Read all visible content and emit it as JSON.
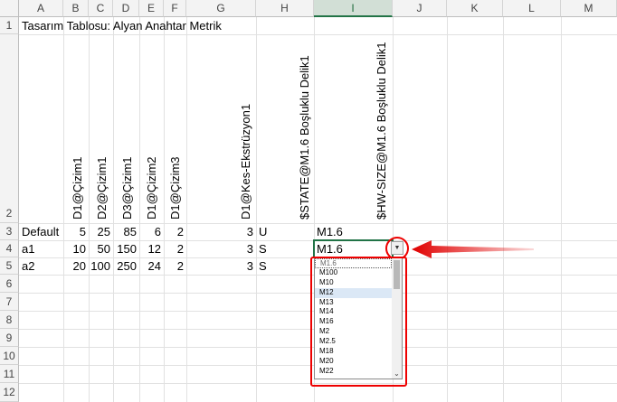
{
  "columns": [
    "A",
    "B",
    "C",
    "D",
    "E",
    "F",
    "G",
    "H",
    "I",
    "J",
    "K",
    "L",
    "M"
  ],
  "selected_column": "I",
  "rows": [
    "1",
    "2",
    "3",
    "4",
    "5",
    "6",
    "7",
    "8",
    "9",
    "10",
    "11",
    "12"
  ],
  "title": "Tasarım Tablosu: Alyan Anahtar Metrik",
  "headers": [
    "D1@Çizim1",
    "D2@Çizim1",
    "D3@Çizim1",
    "D1@Çizim2",
    "D1@Çizim3",
    "D1@Kes-Ekstrüzyon1",
    "$STATE@M1.6 Boşluklu Delik1",
    "$HW-SIZE@M1.6 Boşluklu Delik1"
  ],
  "data_rows": [
    {
      "name": "Default",
      "b": "5",
      "c": "25",
      "d": "85",
      "e": "6",
      "f": "2",
      "g": "3",
      "h": "U",
      "i": "M1.6"
    },
    {
      "name": "a1",
      "b": "10",
      "c": "50",
      "d": "150",
      "e": "12",
      "f": "2",
      "g": "3",
      "h": "S",
      "i": "M1.6"
    },
    {
      "name": "a2",
      "b": "20",
      "c": "100",
      "d": "250",
      "e": "24",
      "f": "2",
      "g": "3",
      "h": "S",
      "i": ""
    }
  ],
  "dropdown": {
    "options": [
      "M1.6",
      "M100",
      "M10",
      "M12",
      "M13",
      "M14",
      "M16",
      "M2",
      "M2.5",
      "M18",
      "M20",
      "M22"
    ],
    "highlighted": "M12"
  },
  "colors": {
    "accent": "#217346",
    "annotation": "#e00000"
  },
  "icons": {
    "dropdown": "dropdown-arrow-icon",
    "scroll_down": "chevron-down-icon"
  }
}
